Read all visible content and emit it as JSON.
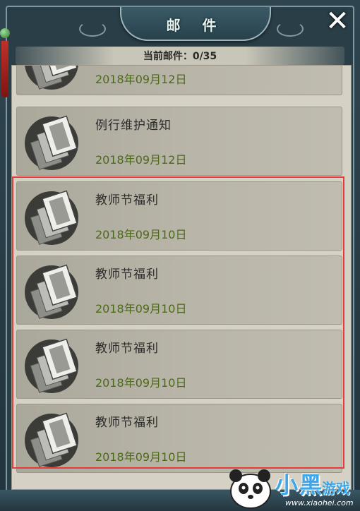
{
  "window": {
    "title": "邮 件",
    "close_glyph": "✕"
  },
  "counter": {
    "text": "当前邮件：0/35"
  },
  "mails": [
    {
      "title": "",
      "date": "2018年09月12日"
    },
    {
      "title": "例行维护通知",
      "date": "2018年09月12日"
    },
    {
      "title": "教师节福利",
      "date": "2018年09月10日"
    },
    {
      "title": "教师节福利",
      "date": "2018年09月10日"
    },
    {
      "title": "教师节福利",
      "date": "2018年09月10日"
    },
    {
      "title": "教师节福利",
      "date": "2018年09月10日"
    }
  ],
  "icons": {
    "mail": "mail-envelope-icon",
    "close": "close-icon"
  },
  "colors": {
    "date": "#4b6a16",
    "highlight": "#e53b3b",
    "panel": "#d5d1c4"
  },
  "watermark": {
    "brand": "小黑",
    "brand2": "游戏",
    "url": "www.xiaohei.com"
  }
}
